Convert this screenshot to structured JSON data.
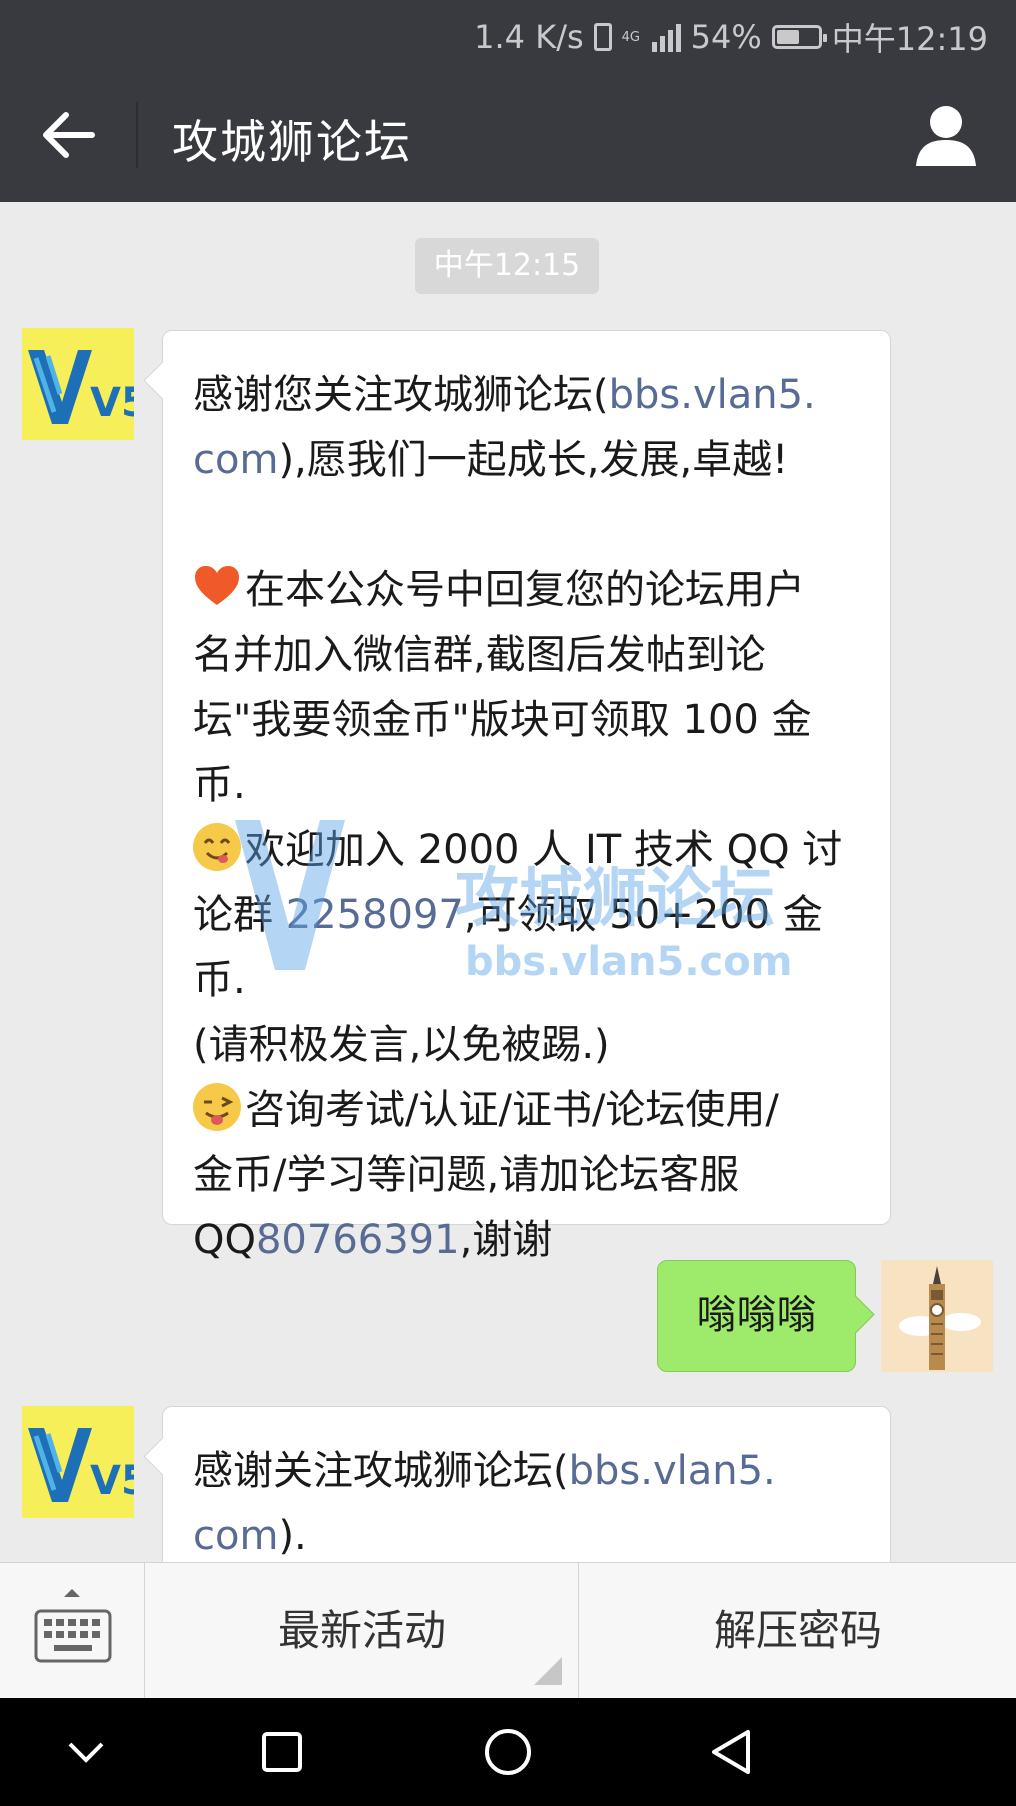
{
  "status_bar": {
    "speed": "1.4 K/s",
    "network_label": "4G",
    "battery_percent": "54%",
    "time": "中午12:19"
  },
  "header": {
    "title": "攻城狮论坛"
  },
  "chat": {
    "timestamp": "中午12:15",
    "msg1": {
      "l1a": "感谢您关注攻城狮论坛(",
      "l1b": "bbs.vlan5.",
      "l2a": "com",
      "l2b": "),愿我们一起成长,发展,卓越!",
      "heart_text": "在本公众号中回复您的论坛用户",
      "l4": "名并加入微信群,截图后发帖到论",
      "l5": "坛\"我要领金币\"版块可领取 100 金",
      "l6": "币.",
      "smile_text": "欢迎加入 2000 人 IT 技术 QQ 讨",
      "l8a": "论群 ",
      "l8b": "2258097",
      "l8c": ",可领取 50+200 金币.",
      "l9": "(请积极发言,以免被踢.)",
      "wink_text": "咨询考试/认证/证书/论坛使用/",
      "l11": "金币/学习等问题,请加论坛客服",
      "l12a": "QQ",
      "l12b": "80766391",
      "l12c": ",谢谢"
    },
    "msg2": {
      "text": "嗡嗡嗡"
    },
    "msg3": {
      "l1a": "感谢关注攻城狮论坛(",
      "l1b": "bbs.vlan5.",
      "l2a": "com",
      "l2b": ")."
    },
    "watermark": {
      "title": "攻城狮论坛",
      "url": "bbs.vlan5.com"
    }
  },
  "avatar_logo": "V5",
  "menu": {
    "item1": "最新活动",
    "item2": "解压密码"
  },
  "colors": {
    "link": "#576b95",
    "header_bg": "#393a3f",
    "my_bubble": "#9eea6a",
    "chat_bg": "#ebebeb"
  }
}
